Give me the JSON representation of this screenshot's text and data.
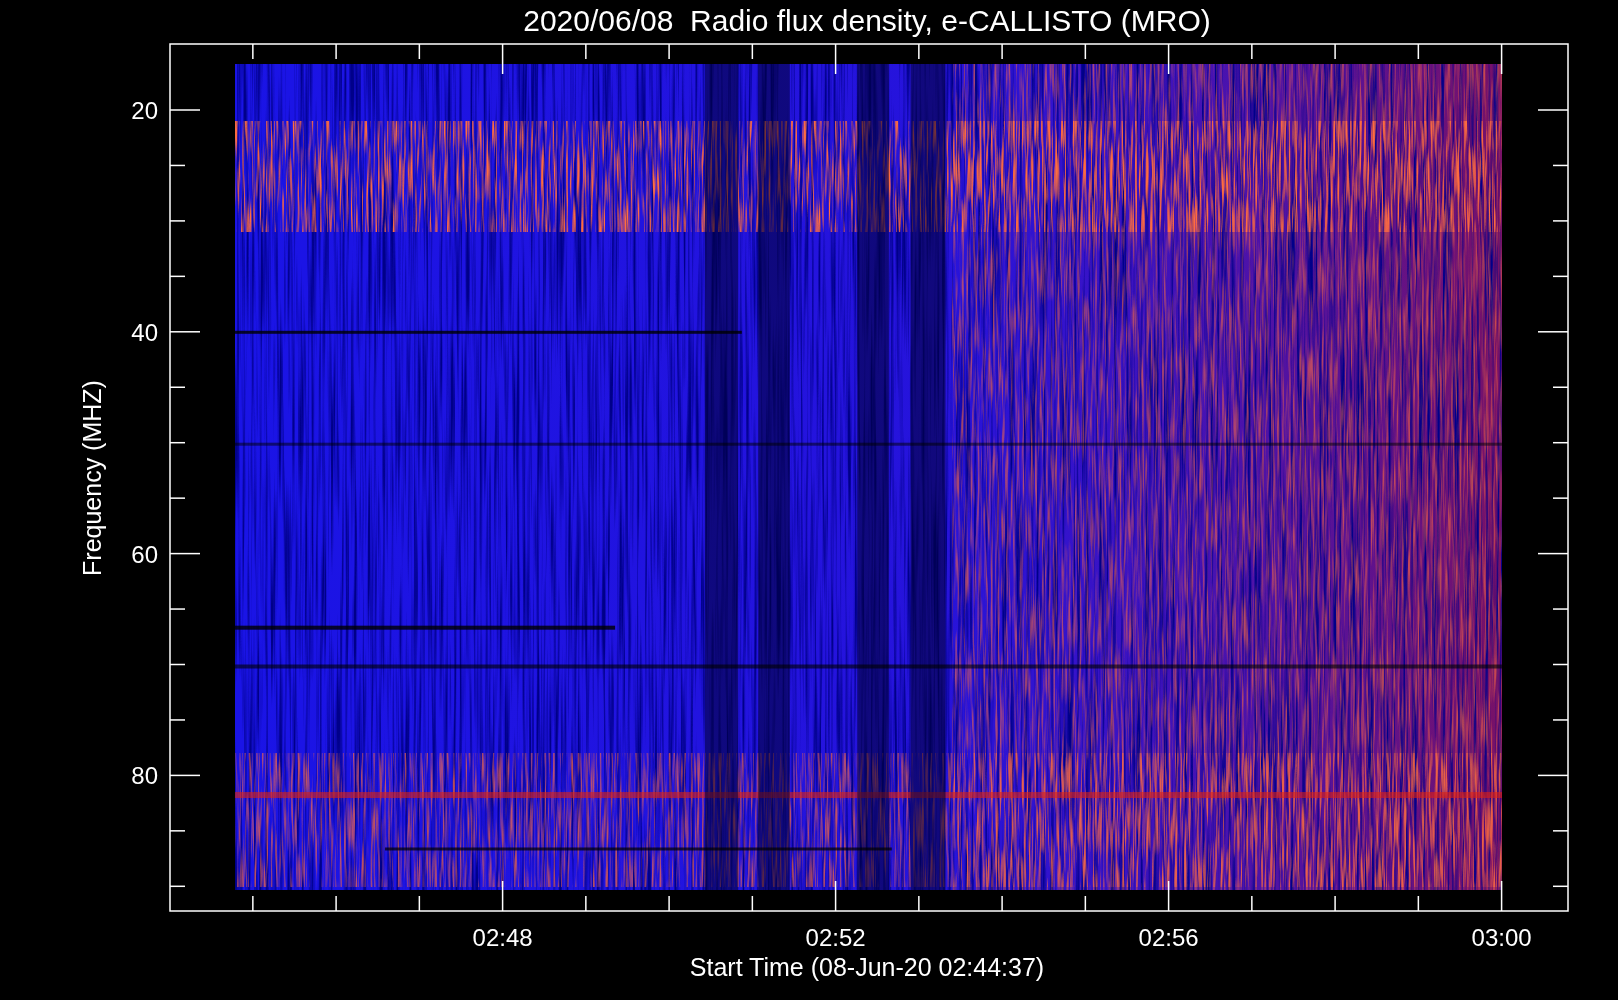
{
  "plot": {
    "title": "2020/06/08  Radio flux density, e-CALLISTO (MRO)",
    "xlabel": "Start Time (08-Jun-20 02:44:37)",
    "ylabel": "Frequency (MHZ)",
    "yticks": [
      {
        "label": "20"
      },
      {
        "label": "40"
      },
      {
        "label": "60"
      },
      {
        "label": "80"
      }
    ],
    "xticks": [
      {
        "label": "02:48"
      },
      {
        "label": "02:52"
      },
      {
        "label": "02:56"
      },
      {
        "label": "03:00"
      }
    ]
  }
}
